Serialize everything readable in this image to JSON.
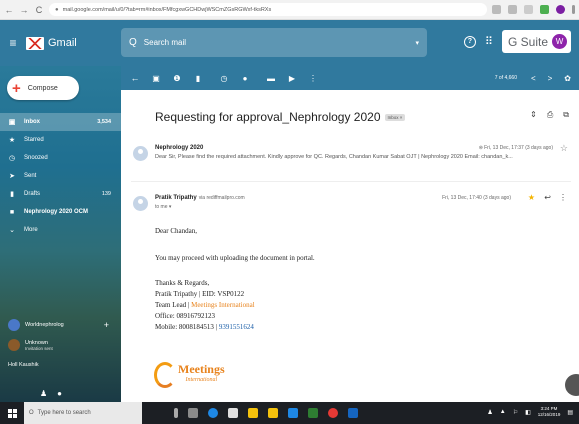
{
  "browser": {
    "url": "mail.google.com/mail/u/0/?tab=rm#inbox/FMfcgxwGCHDwjWSCmZGsRGWxf-tksRXs",
    "back_glyph": "←",
    "forward_glyph": "→",
    "reload_glyph": "C",
    "lock_glyph": "●"
  },
  "gmail": {
    "menu_glyph": "≡",
    "logo_text": "Gmail",
    "search_placeholder": "Search mail",
    "search_glyph": "Q",
    "search_options_glyph": "▾",
    "help_glyph": "?",
    "apps_glyph": "⠿",
    "gsuite_label": "G Suite",
    "avatar_letter": "W"
  },
  "sidebar": {
    "compose_label": "Compose",
    "items": [
      {
        "label": "Inbox",
        "count": "3,534",
        "active": true,
        "glyph": "▣"
      },
      {
        "label": "Starred",
        "count": "",
        "glyph": "★"
      },
      {
        "label": "Snoozed",
        "count": "",
        "glyph": "◷"
      },
      {
        "label": "Sent",
        "count": "",
        "glyph": "➤"
      },
      {
        "label": "Drafts",
        "count": "139",
        "glyph": "▮"
      },
      {
        "label": "Nephrology 2020 OCM",
        "count": "",
        "glyph": "■"
      },
      {
        "label": "More",
        "count": "",
        "glyph": "⌄"
      }
    ],
    "hangouts": [
      {
        "name": "Worldnephrolog",
        "sub": "",
        "plus": "+"
      },
      {
        "name": "Unknown",
        "sub": "Invitation sent",
        "plus": ""
      },
      {
        "name": "Holl Kaushik",
        "sub": "",
        "plus": ""
      }
    ]
  },
  "toolbar": {
    "back_glyph": "←",
    "icons": [
      "▣",
      "❶",
      "▮",
      "◷",
      "●",
      "▬",
      "▶",
      "⋮"
    ],
    "pager": "7 of 4,660",
    "prev_glyph": "<",
    "next_glyph": ">",
    "settings_glyph": "✿"
  },
  "thread": {
    "subject": "Requesting for approval_Nephrology 2020",
    "label_chip": "Inbox ×",
    "action_glyphs": [
      "⇕",
      "⎙",
      "⧉"
    ],
    "message1": {
      "from": "Nephrology 2020",
      "snippet": "Dear Sir, Please find the required attachment. Kindly approve for QC. Regards, Chandan Kumar Sabat OJT | Nephrology 2020 Email: chandan_k...",
      "attachment_glyph": "⊜",
      "date": "Fri, 13 Dec, 17:37 (3 days ago)",
      "star_glyph": "☆"
    },
    "message2": {
      "from_name": "Pratik Tripathy",
      "from_email": "via rediffmailpro.com",
      "to": "to me ▾",
      "date": "Fri, 13 Dec, 17:40 (3 days ago)",
      "star_glyph": "★",
      "reply_glyph": "↩",
      "more_glyph": "⋮"
    },
    "body": {
      "greeting": "Dear Chandan,",
      "line1": "You may proceed with uploading the document in portal.",
      "closing": "Thanks & Regards,",
      "sig_name": "Pratik Tripathy | EID: VSP0122",
      "sig_title_prefix": "Team Lead | ",
      "sig_company": "Meetings International",
      "sig_office": "Office: 08916792123",
      "sig_mobile_prefix": "Mobile: 8008184513 | ",
      "sig_mobile_link": "9391551624",
      "logo_text": "Meetings",
      "logo_sub": "International"
    }
  },
  "taskbar": {
    "search_placeholder": "Type here to search",
    "search_glyph": "O",
    "time": "3:24 PM",
    "date": "12/16/2019",
    "tray_glyphs": [
      "▲",
      "⚐",
      "◧",
      "ENG"
    ]
  },
  "colors": {
    "header": "#1e6e96",
    "avatar": "#8e24aa",
    "accent_orange": "#e8831d",
    "link": "#1a5ea8"
  }
}
